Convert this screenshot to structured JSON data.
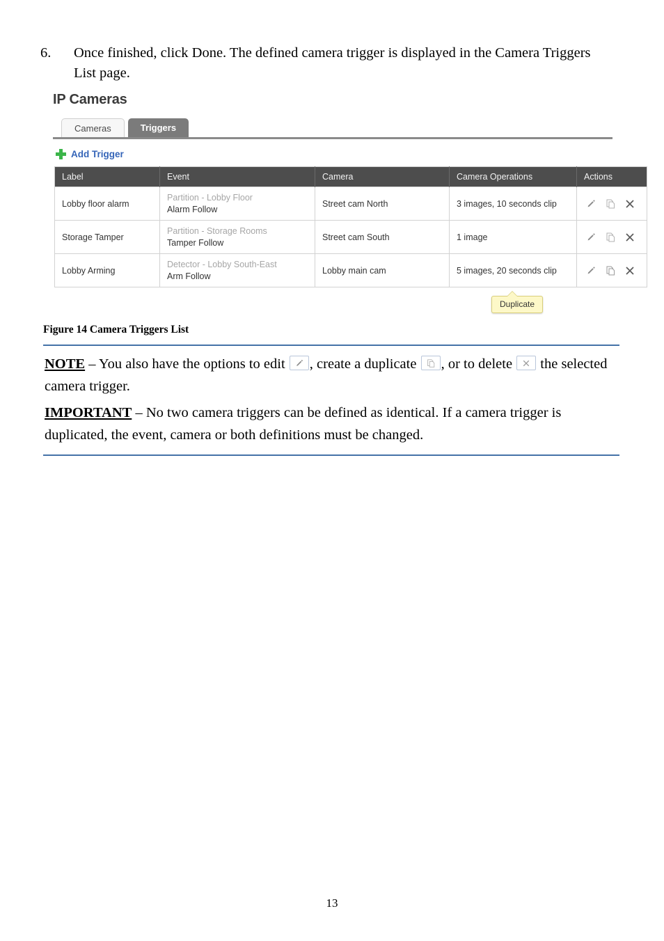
{
  "document": {
    "step": {
      "number": "6.",
      "text": "Once finished, click Done. The defined camera trigger is displayed in the Camera Triggers List page."
    },
    "figure_caption": "Figure 14 Camera Triggers List",
    "page_number": "13"
  },
  "app": {
    "title": "IP Cameras",
    "tabs": [
      {
        "label": "Cameras",
        "active": false
      },
      {
        "label": "Triggers",
        "active": true
      }
    ],
    "add_trigger_label": "Add Trigger",
    "add_trigger_icon": "plus-icon",
    "table": {
      "headers": [
        "Label",
        "Event",
        "Camera",
        "Camera Operations",
        "Actions"
      ],
      "rows": [
        {
          "label": "Lobby floor alarm",
          "event_source": "Partition - Lobby Floor",
          "event_name": "Alarm Follow",
          "camera": "Street cam North",
          "operations": "3 images, 10 seconds clip",
          "actions": [
            "edit-icon",
            "duplicate-icon",
            "delete-icon"
          ]
        },
        {
          "label": "Storage Tamper",
          "event_source": "Partition - Storage Rooms",
          "event_name": "Tamper Follow",
          "camera": "Street cam South",
          "operations": "1 image",
          "actions": [
            "edit-icon",
            "duplicate-icon",
            "delete-icon"
          ]
        },
        {
          "label": "Lobby Arming",
          "event_source": "Detector - Lobby South-East",
          "event_name": "Arm Follow",
          "camera": "Lobby main cam",
          "operations": "5 images, 20 seconds clip",
          "actions": [
            "edit-icon",
            "duplicate-icon",
            "delete-icon"
          ]
        }
      ]
    },
    "tooltip": {
      "text": "Duplicate"
    }
  },
  "note_block": {
    "note": {
      "keyword": "NOTE",
      "part1": " – You also have the options to edit ",
      "part2": ", create a duplicate ",
      "part3": ", or to delete ",
      "part4": " the selected camera trigger."
    },
    "important": {
      "keyword": "IMPORTANT",
      "text": " – No two camera triggers can be defined as identical. If a camera trigger is duplicated, the event, camera or both definitions must be changed."
    }
  },
  "colors": {
    "tab_active_bg": "#7b7b7b",
    "table_header_bg": "#4d4d4d",
    "link_blue": "#3565b8",
    "plus_green": "#3cb54a",
    "rule_blue": "#4472a8",
    "tooltip_bg": "#fdf8c8"
  }
}
